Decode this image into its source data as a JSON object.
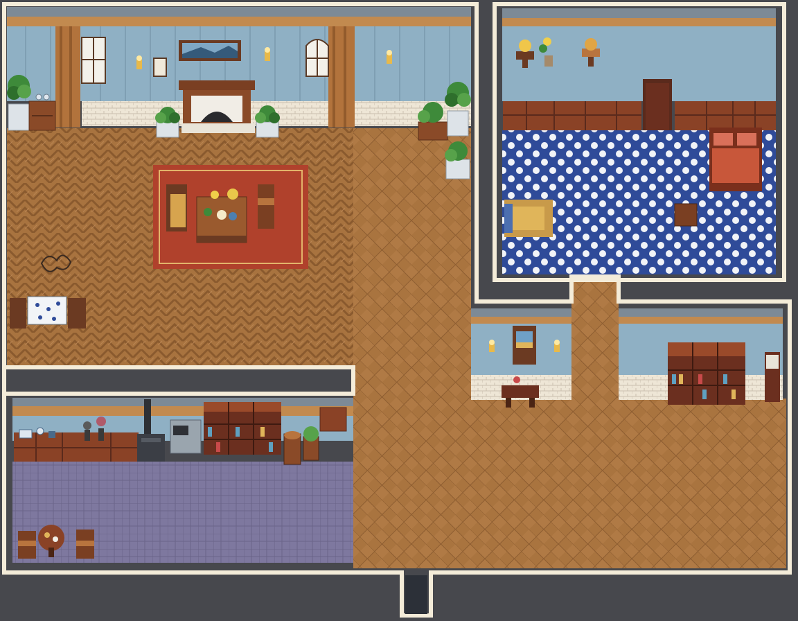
{
  "map": {
    "rooms": [
      "living-room",
      "bedroom",
      "kitchen",
      "study",
      "library"
    ],
    "colors": {
      "void": "#47484d",
      "wall_trim": "#f4ecd9",
      "wall_blue": "#8fb0c4",
      "wood_floor": "#a8733f",
      "kitchen_floor": "#7d779e",
      "bedroom_floor_blue": "#2f4b99",
      "rug_red": "#b0412c",
      "wood_dark": "#6b3a22"
    }
  }
}
